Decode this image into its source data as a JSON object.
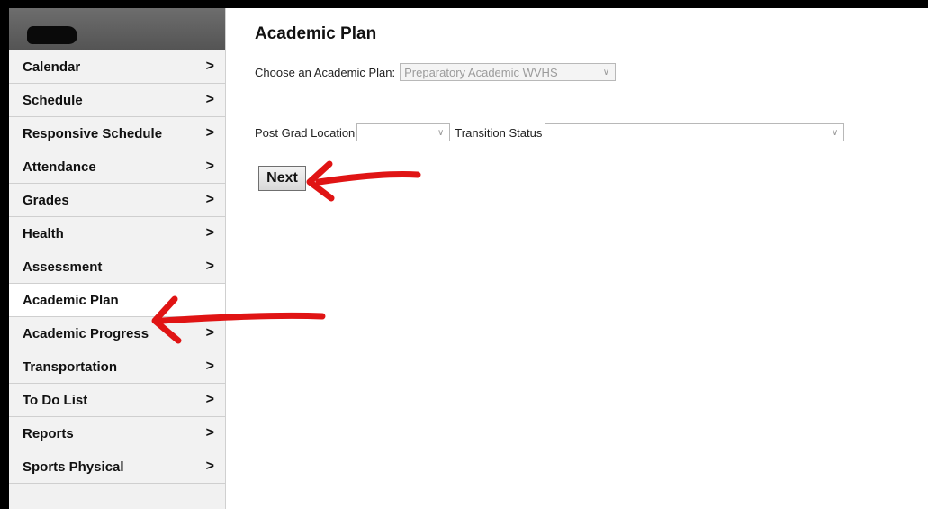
{
  "sidebar": {
    "items": [
      {
        "label": "Calendar",
        "chevron": ">"
      },
      {
        "label": "Schedule",
        "chevron": ">"
      },
      {
        "label": "Responsive Schedule",
        "chevron": ">"
      },
      {
        "label": "Attendance",
        "chevron": ">"
      },
      {
        "label": "Grades",
        "chevron": ">"
      },
      {
        "label": "Health",
        "chevron": ">"
      },
      {
        "label": "Assessment",
        "chevron": ">"
      },
      {
        "label": "Academic Plan",
        "chevron": ""
      },
      {
        "label": "Academic Progress",
        "chevron": ">"
      },
      {
        "label": "Transportation",
        "chevron": ">"
      },
      {
        "label": "To Do List",
        "chevron": ">"
      },
      {
        "label": "Reports",
        "chevron": ">"
      },
      {
        "label": "Sports Physical",
        "chevron": ">"
      }
    ],
    "active_item": "Academic Plan"
  },
  "main": {
    "title": "Academic Plan",
    "plan_label": "Choose an Academic Plan:",
    "plan_value": "Preparatory Academic WVHS",
    "post_grad_label": "Post Grad Location",
    "post_grad_value": "",
    "transition_label": "Transition Status",
    "transition_value": "",
    "next_label": "Next"
  },
  "annotations": {
    "arrow_color": "#e01414"
  }
}
